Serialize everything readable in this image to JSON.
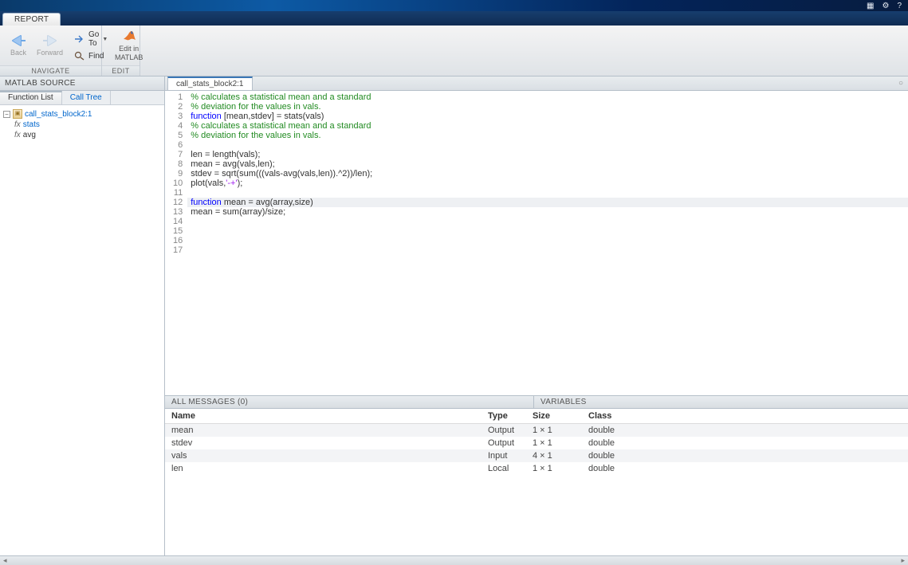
{
  "app": {
    "tab_label": "REPORT",
    "title_icons": [
      "grid-icon",
      "gear-icon",
      "help-icon"
    ]
  },
  "toolstrip": {
    "navigate_label": "NAVIGATE",
    "edit_label": "EDIT",
    "back_label": "Back",
    "forward_label": "Forward",
    "goto_label": "Go To",
    "find_label": "Find",
    "edit_in_label1": "Edit in",
    "edit_in_label2": "MATLAB"
  },
  "left": {
    "panel_title": "MATLAB SOURCE",
    "tab_function_list": "Function List",
    "tab_call_tree": "Call Tree",
    "tree": {
      "root": "call_stats_block2:1",
      "items": [
        {
          "fx": "fx",
          "name": "stats",
          "selected": true
        },
        {
          "fx": "fx",
          "name": "avg",
          "selected": false
        }
      ]
    }
  },
  "editor": {
    "file_tab": "call_stats_block2:1",
    "highlight_line": 12,
    "lines": [
      {
        "n": 1,
        "tokens": [
          [
            "cm",
            "% calculates a statistical mean and a standard"
          ]
        ]
      },
      {
        "n": 2,
        "tokens": [
          [
            "cm",
            "% deviation for the values in vals."
          ]
        ]
      },
      {
        "n": 3,
        "tokens": [
          [
            "kw",
            "function"
          ],
          [
            "",
            " [mean,stdev] = stats(vals)"
          ]
        ]
      },
      {
        "n": 4,
        "tokens": [
          [
            "cm",
            "% calculates a statistical mean and a standard"
          ]
        ]
      },
      {
        "n": 5,
        "tokens": [
          [
            "cm",
            "% deviation for the values in vals."
          ]
        ]
      },
      {
        "n": 6,
        "tokens": []
      },
      {
        "n": 7,
        "tokens": [
          [
            "",
            "len = length(vals);"
          ]
        ]
      },
      {
        "n": 8,
        "tokens": [
          [
            "",
            "mean = avg(vals,len);"
          ]
        ]
      },
      {
        "n": 9,
        "tokens": [
          [
            "",
            "stdev = sqrt(sum(((vals-avg(vals,len)).^2))/len);"
          ]
        ]
      },
      {
        "n": 10,
        "tokens": [
          [
            "",
            "plot(vals,"
          ],
          [
            "str",
            "'-+'"
          ],
          [
            "",
            ");"
          ]
        ]
      },
      {
        "n": 11,
        "tokens": []
      },
      {
        "n": 12,
        "tokens": [
          [
            "kw",
            "function"
          ],
          [
            "",
            " mean = avg(array,size)"
          ]
        ]
      },
      {
        "n": 13,
        "tokens": [
          [
            "",
            "mean = sum(array)/size;"
          ]
        ]
      },
      {
        "n": 14,
        "tokens": []
      },
      {
        "n": 15,
        "tokens": []
      },
      {
        "n": 16,
        "tokens": []
      },
      {
        "n": 17,
        "tokens": []
      }
    ]
  },
  "messages": {
    "label": "ALL MESSAGES (0)"
  },
  "variables": {
    "label": "VARIABLES",
    "headers": {
      "name": "Name",
      "type": "Type",
      "size": "Size",
      "class": "Class"
    },
    "rows": [
      {
        "name": "mean",
        "type": "Output",
        "size": "1 × 1",
        "class": "double"
      },
      {
        "name": "stdev",
        "type": "Output",
        "size": "1 × 1",
        "class": "double"
      },
      {
        "name": "vals",
        "type": "Input",
        "size": "4 × 1",
        "class": "double"
      },
      {
        "name": "len",
        "type": "Local",
        "size": "1 × 1",
        "class": "double"
      }
    ]
  }
}
